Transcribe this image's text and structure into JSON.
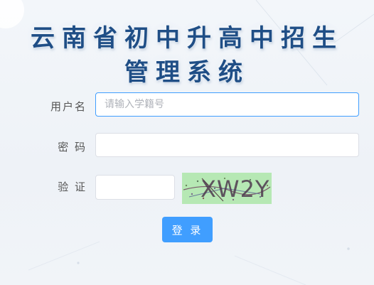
{
  "header": {
    "title_line1": "云南省初中升高中招生",
    "title_line2": "管理系统"
  },
  "form": {
    "username": {
      "label": "用户名",
      "placeholder": "请输入学籍号",
      "value": ""
    },
    "password": {
      "label": "密 码",
      "value": ""
    },
    "verify": {
      "label": "验 证",
      "value": "",
      "captcha_text": "XW2Y"
    },
    "submit_label": "登 录"
  },
  "colors": {
    "title": "#1f4e86",
    "accent": "#409eff",
    "captcha_bg": "#b6e8b4"
  }
}
